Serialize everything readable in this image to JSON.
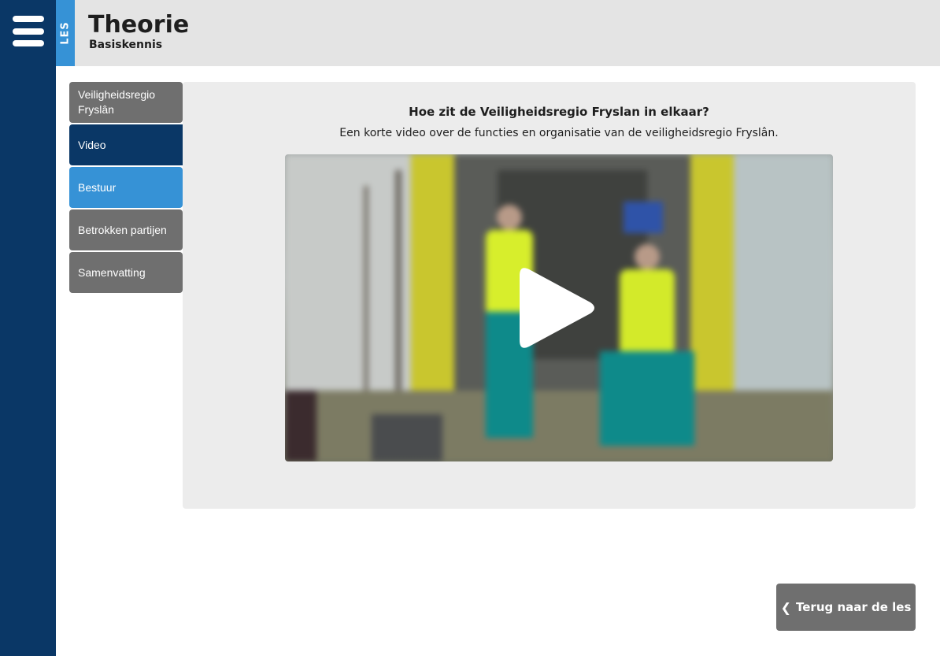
{
  "header": {
    "tag": "LES",
    "title": "Theorie",
    "subtitle": "Basiskennis"
  },
  "menu": {
    "items": [
      {
        "label": "Veiligheidsregio Fryslân",
        "state": "gray"
      },
      {
        "label": "Video",
        "state": "active",
        "icon": "play-icon"
      },
      {
        "label": "Bestuur",
        "state": "blue"
      },
      {
        "label": "Betrokken partijen",
        "state": "gray"
      },
      {
        "label": "Samenvatting",
        "state": "gray"
      }
    ]
  },
  "content": {
    "title": "Hoe zit de Veiligheidsregio Fryslan in elkaar?",
    "description": "Een korte video over de functies en organisatie van de veiligheidsregio Fryslân."
  },
  "video": {
    "icon": "play-icon"
  },
  "footer": {
    "back_label": "Terug naar de les",
    "back_icon": "chevron-left-icon"
  },
  "colors": {
    "nav_dark": "#0a3766",
    "accent_blue": "#3692d6",
    "menu_gray": "#6f6f6f",
    "header_bg": "#e4e4e4",
    "panel_bg": "#ececec"
  }
}
